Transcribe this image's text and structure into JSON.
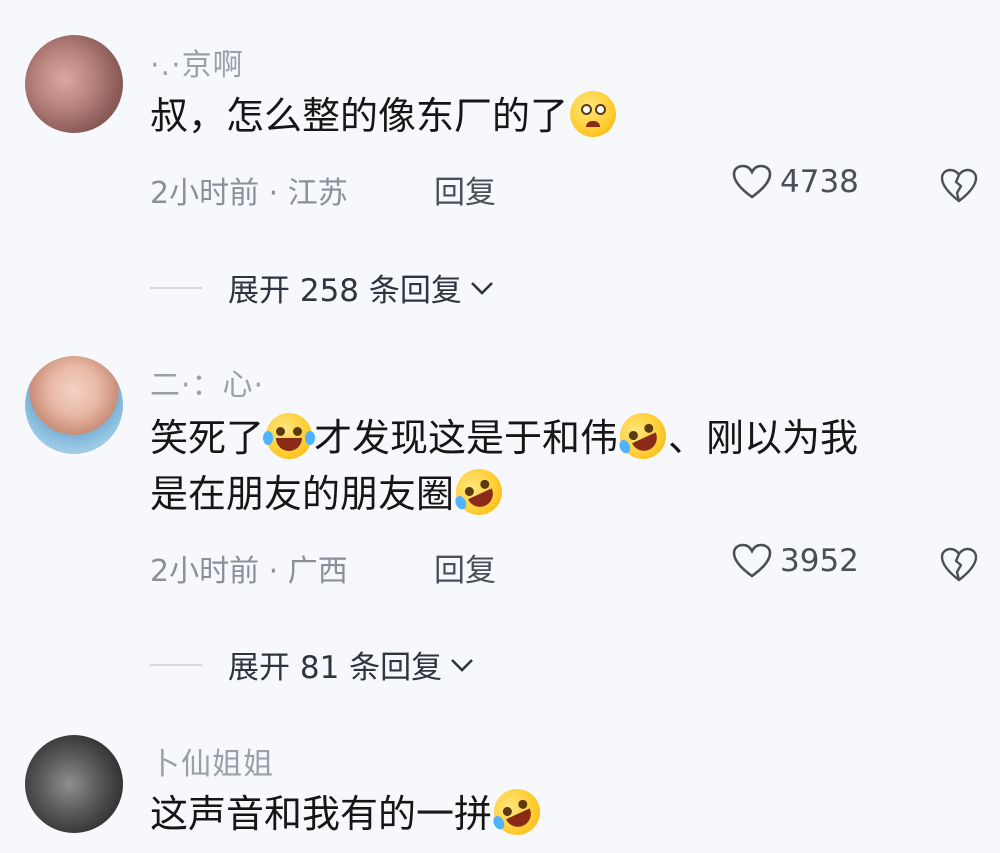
{
  "comments": [
    {
      "username": "·.·京啊",
      "text": "叔，怎么整的像东厂的了",
      "emoji": "pleading-face",
      "time": "2小时前",
      "location": "江苏",
      "reply": "回复",
      "likes": "4738",
      "expand": "展开 258 条回复"
    },
    {
      "username": "二·：心·",
      "text_line1": "笑死了",
      "text_mid1": "才发现这是于和伟",
      "text_mid2": "、刚以为我",
      "text_line2": "是在朋友的朋友圈",
      "emoji": "rofl",
      "time": "2小时前",
      "location": "广西",
      "reply": "回复",
      "likes": "3952",
      "expand": "展开 81 条回复"
    },
    {
      "username": "卜仙姐姐",
      "text": "这声音和我有的一拼",
      "emoji": "rofl"
    }
  ],
  "separator": "·"
}
